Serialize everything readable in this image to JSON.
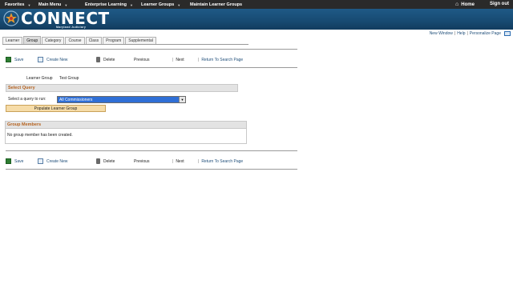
{
  "topnav": {
    "favorites": "Favorites",
    "main_menu": "Main Menu",
    "enterprise_learning": "Enterprise Learning",
    "learner_groups": "Learner Groups",
    "maintain_learner_groups": "Maintain Learner Groups",
    "home": "Home",
    "sign_out": "Sign out"
  },
  "header": {
    "logo_text": "CONNECT",
    "logo_subtitle": "Maryland Judiciary"
  },
  "util_links": {
    "new_window": "New Window",
    "help": "Help",
    "personalize_page": "Personalize Page",
    "sep": "|"
  },
  "tabs": [
    {
      "label": "Learner",
      "active": false
    },
    {
      "label": "Group",
      "active": true
    },
    {
      "label": "Category",
      "active": false
    },
    {
      "label": "Course",
      "active": false
    },
    {
      "label": "Class",
      "active": false
    },
    {
      "label": "Program",
      "active": false
    },
    {
      "label": "Supplemental",
      "active": false
    }
  ],
  "toolbar": {
    "save": "Save",
    "create_new": "Create New",
    "delete": "Delete",
    "previous": "Previous",
    "next": "Next",
    "return_to_search": "Return To Search Page",
    "pipe": "|"
  },
  "learner_group": {
    "label": "Learner Group",
    "value": "Test Group"
  },
  "select_query": {
    "header": "Select Query",
    "label": "Select a query to run:",
    "selected": "All Commissioners",
    "populate_button": "Populate Learner Group"
  },
  "group_members": {
    "header": "Group Members",
    "empty_message": "No group member has been created."
  },
  "colors": {
    "topnav_bg": "#2a2a2a",
    "banner_bg": "#1f5a86",
    "link": "#1f4e79",
    "section_header_text": "#b5621f",
    "select_highlight": "#2f6fd6",
    "button_bg": "#f6dca8"
  }
}
